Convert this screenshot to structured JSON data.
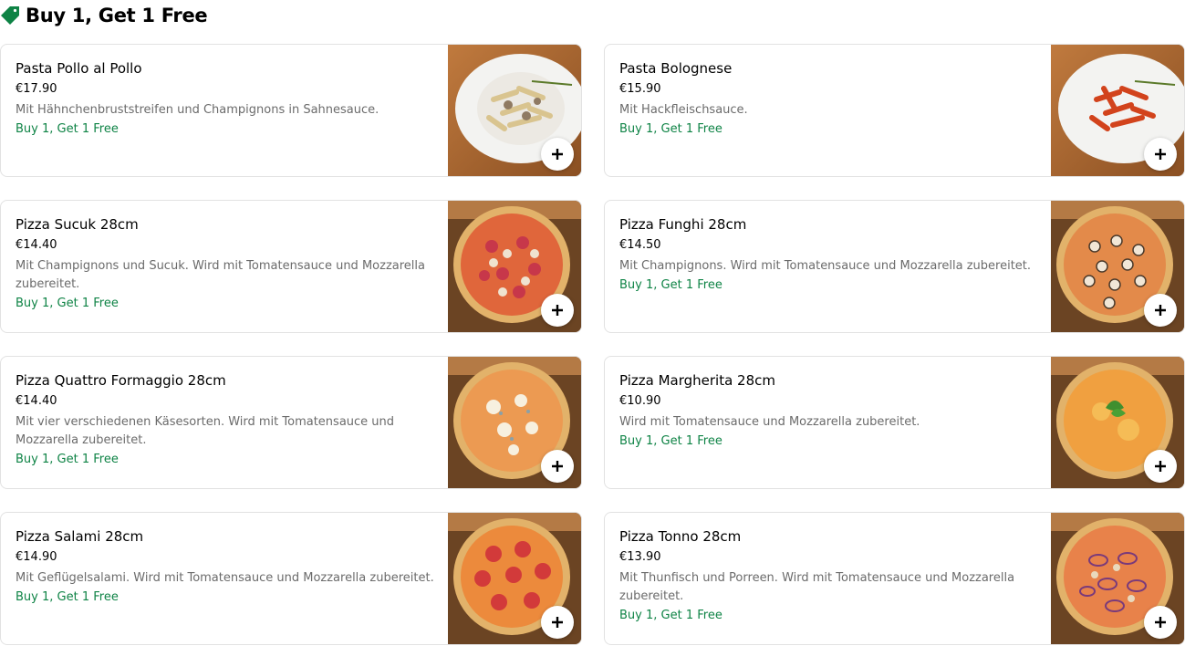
{
  "section": {
    "title": "Buy 1, Get 1 Free",
    "icon": "tag-icon",
    "accent_color": "#0e8345"
  },
  "items": [
    {
      "name": "Pasta Pollo al Pollo",
      "price": "€17.90",
      "description": "Mit Hähnchenbruststreifen und Champignons in Sahnesauce.",
      "promo": "Buy 1, Get 1 Free",
      "image": "pasta-cream"
    },
    {
      "name": "Pasta Bolognese",
      "price": "€15.90",
      "description": "Mit Hackfleischsauce.",
      "promo": "Buy 1, Get 1 Free",
      "image": "pasta-red"
    },
    {
      "name": "Pizza Sucuk 28cm",
      "price": "€14.40",
      "description": "Mit Champignons und Sucuk. Wird mit Tomatensauce und Mozzarella zubereitet.",
      "promo": "Buy 1, Get 1 Free",
      "image": "pizza-sucuk"
    },
    {
      "name": "Pizza Funghi 28cm",
      "price": "€14.50",
      "description": "Mit Champignons. Wird mit Tomatensauce und Mozzarella zubereitet.",
      "promo": "Buy 1, Get 1 Free",
      "image": "pizza-funghi"
    },
    {
      "name": "Pizza Quattro Formaggio 28cm",
      "price": "€14.40",
      "description": "Mit vier verschiedenen Käsesorten. Wird mit Tomatensauce und Mozzarella zubereitet.",
      "promo": "Buy 1, Get 1 Free",
      "image": "pizza-cheese"
    },
    {
      "name": "Pizza Margherita 28cm",
      "price": "€10.90",
      "description": "Wird mit Tomatensauce und Mozzarella zubereitet.",
      "promo": "Buy 1, Get 1 Free",
      "image": "pizza-margherita"
    },
    {
      "name": "Pizza Salami 28cm",
      "price": "€14.90",
      "description": "Mit Geflügelsalami. Wird mit Tomatensauce und Mozzarella zubereitet.",
      "promo": "Buy 1, Get 1 Free",
      "image": "pizza-salami"
    },
    {
      "name": "Pizza Tonno 28cm",
      "price": "€13.90",
      "description": "Mit Thunfisch und Porreen. Wird mit Tomatensauce und Mozzarella zubereitet.",
      "promo": "Buy 1, Get 1 Free",
      "image": "pizza-tonno"
    }
  ]
}
